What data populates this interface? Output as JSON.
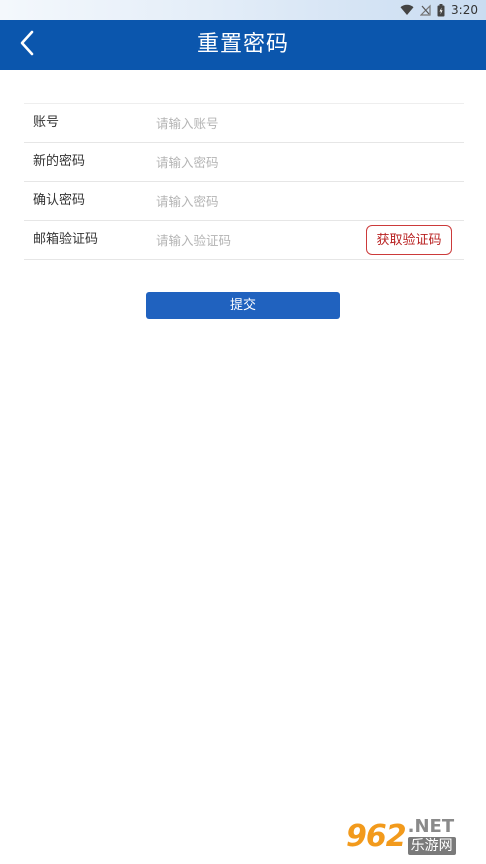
{
  "status_bar": {
    "time": "3:20",
    "icons": [
      "wifi-icon",
      "no-signal-icon",
      "battery-charging-icon"
    ]
  },
  "header": {
    "back_icon": "chevron-left-icon",
    "title": "重置密码",
    "background": "#0b56ad"
  },
  "form": {
    "fields": [
      {
        "label": "账号",
        "placeholder": "请输入账号",
        "value": ""
      },
      {
        "label": "新的密码",
        "placeholder": "请输入密码",
        "value": ""
      },
      {
        "label": "确认密码",
        "placeholder": "请输入密码",
        "value": ""
      },
      {
        "label": "邮箱验证码",
        "placeholder": "请输入验证码",
        "value": ""
      }
    ],
    "get_code_label": "获取验证码",
    "submit_label": "提交"
  },
  "watermark": {
    "logo": "962",
    "domain": ".NET",
    "site_name": "乐游网"
  },
  "colors": {
    "accent": "#0b56ad",
    "button": "#2062bf",
    "code_button_border": "#cc3a3a"
  }
}
